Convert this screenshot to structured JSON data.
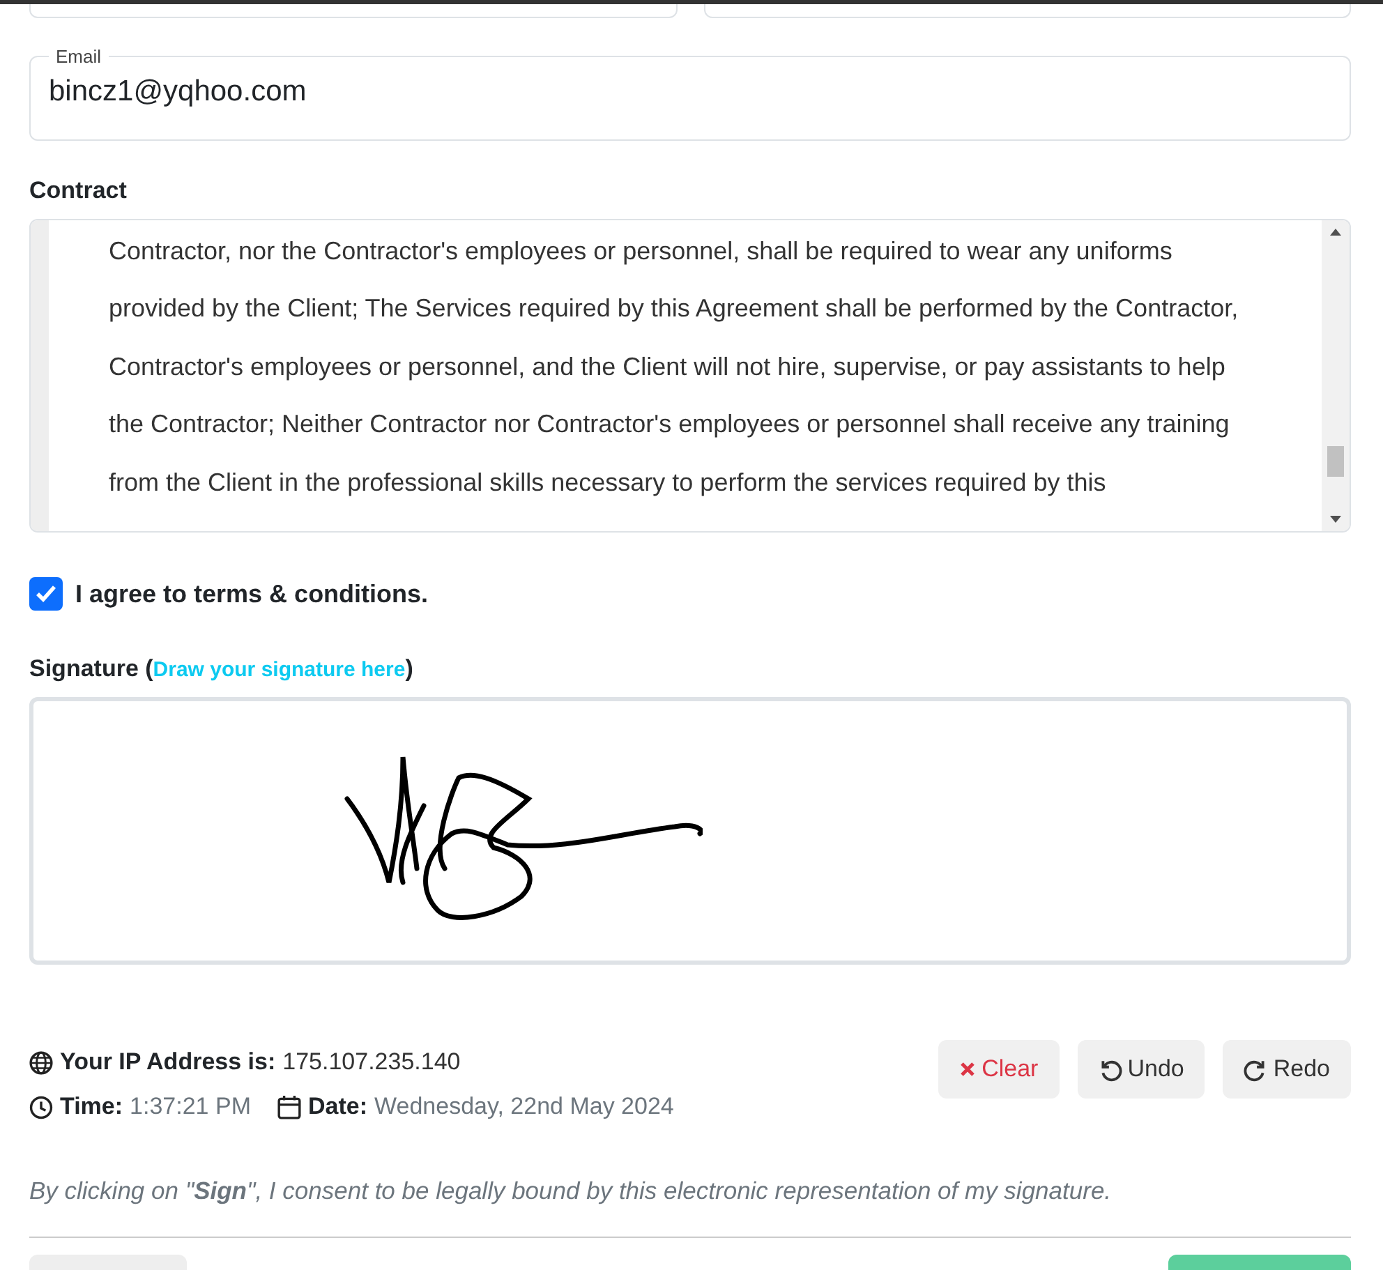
{
  "email": {
    "label": "Email",
    "value": "bincz1@yqhoo.com"
  },
  "contract": {
    "label": "Contract",
    "lines": [
      "Contractor, nor the Contractor's employees or personnel, shall be required to wear any uniforms",
      "provided by the Client; The Services required by this Agreement shall be performed by the Contractor,",
      "Contractor's employees or personnel, and the Client will not hire, supervise, or pay assistants to help",
      "the Contractor; Neither Contractor nor Contractor's employees or personnel shall receive any training",
      "from the Client in the professional skills necessary to perform the services required by this"
    ]
  },
  "agree": {
    "label": "I agree to terms & conditions.",
    "checked": true
  },
  "signature": {
    "label": "Signature (",
    "hint": "Draw your signature here",
    "close": ")"
  },
  "ip": {
    "label": "Your IP Address is:",
    "value": "175.107.235.140"
  },
  "time": {
    "label": "Time:",
    "value": "1:37:21 PM"
  },
  "date": {
    "label": "Date:",
    "value": "Wednesday, 22nd May 2024"
  },
  "actions": [
    {
      "kind": "clear",
      "label": "Clear"
    },
    {
      "kind": "undo",
      "label": "Undo"
    },
    {
      "kind": "redo",
      "label": "Redo"
    }
  ],
  "consent": "By clicking on \"**Sign**\", I consent to be legally bound by this electronic representation of my signature."
}
